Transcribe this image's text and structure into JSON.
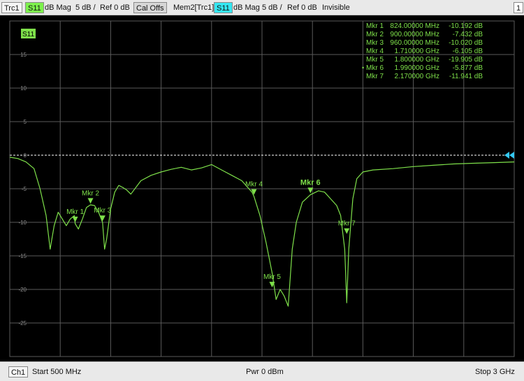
{
  "header": {
    "trace_name": "Trc1",
    "parameter": "S11",
    "format": "dB Mag",
    "scale": "5 dB /",
    "reference": "Ref 0 dB",
    "cal_status": "Cal Offs",
    "memory_trace": "Mem2[Trc1]",
    "memory_parameter": "S11",
    "memory_format": "dB Mag",
    "memory_scale": "5 dB /",
    "memory_reference": "Ref 0 dB",
    "memory_state": "Invisible",
    "window_number": "1"
  },
  "footer": {
    "channel": "Ch1",
    "start": "Start  500 MHz",
    "power": "Pwr  0 dBm",
    "stop": "Stop  3 GHz"
  },
  "colors": {
    "trace": "#7ee04a",
    "grid": "#5a5a5a",
    "axis_text": "#8a8a8a",
    "reference_marker": "#34c8f2",
    "marker_text": "#7ee04a"
  },
  "chart_data": {
    "type": "line",
    "trace_label": "S11",
    "x_unit": "GHz",
    "xlim": [
      0.5,
      3.0
    ],
    "ylim": [
      -30,
      20
    ],
    "y_tick_values": [
      15,
      10,
      5,
      0,
      -5,
      -10,
      -15,
      -20,
      -25
    ],
    "y_tick_labels": [
      "15",
      "10",
      "5",
      "0",
      "-5",
      "-10",
      "-15",
      "-20",
      "-25"
    ],
    "reference_level": 0,
    "x_divisions": 10,
    "grid": true,
    "series": [
      {
        "x": [
          0.5,
          0.54,
          0.58,
          0.62,
          0.65,
          0.68,
          0.7,
          0.72,
          0.74,
          0.76,
          0.78,
          0.8,
          0.82,
          0.824,
          0.84,
          0.86,
          0.88,
          0.9,
          0.92,
          0.94,
          0.96,
          0.97,
          0.98,
          1.0,
          1.02,
          1.04,
          1.06,
          1.08,
          1.1,
          1.15,
          1.2,
          1.25,
          1.3,
          1.35,
          1.4,
          1.45,
          1.5,
          1.55,
          1.6,
          1.65,
          1.7,
          1.71,
          1.74,
          1.77,
          1.8,
          1.82,
          1.84,
          1.86,
          1.88,
          1.9,
          1.92,
          1.95,
          1.99,
          2.03,
          2.06,
          2.09,
          2.12,
          2.14,
          2.16,
          2.17,
          2.18,
          2.2,
          2.22,
          2.25,
          2.3,
          2.4,
          2.5,
          2.6,
          2.7,
          2.8,
          2.9,
          3.0
        ],
        "y": [
          -0.3,
          -0.5,
          -1.0,
          -2.0,
          -5.0,
          -9.0,
          -14.0,
          -10.5,
          -8.5,
          -9.5,
          -10.5,
          -9.5,
          -9.0,
          -10.2,
          -11.0,
          -9.5,
          -7.8,
          -7.4,
          -7.5,
          -8.5,
          -10.0,
          -14.0,
          -12.5,
          -8.0,
          -5.5,
          -4.5,
          -4.8,
          -5.2,
          -5.8,
          -3.8,
          -3.0,
          -2.5,
          -2.1,
          -1.8,
          -2.2,
          -1.9,
          -1.4,
          -2.2,
          -3.0,
          -3.8,
          -5.5,
          -6.1,
          -9.0,
          -13.0,
          -17.5,
          -21.5,
          -20.0,
          -21.0,
          -22.5,
          -14.0,
          -10.0,
          -7.0,
          -5.9,
          -5.3,
          -5.5,
          -6.5,
          -7.5,
          -9.0,
          -14.0,
          -22.0,
          -14.0,
          -6.5,
          -3.5,
          -2.5,
          -2.2,
          -2.0,
          -1.7,
          -1.5,
          -1.3,
          -1.2,
          -1.1,
          -1.0
        ]
      }
    ],
    "markers": [
      {
        "name": "Mkr 1",
        "freq_label": "824.00000 MHz",
        "value_label": "-10.192 dB",
        "x": 0.824,
        "y": -10.192,
        "active": false
      },
      {
        "name": "Mkr 2",
        "freq_label": "900.00000 MHz",
        "value_label": "-7.432 dB",
        "x": 0.9,
        "y": -7.432,
        "active": false
      },
      {
        "name": "Mkr 3",
        "freq_label": "960.00000 MHz",
        "value_label": "-10.020 dB",
        "x": 0.96,
        "y": -10.02,
        "active": false
      },
      {
        "name": "Mkr 4",
        "freq_label": "1.710000 GHz",
        "value_label": "-6.105 dB",
        "x": 1.71,
        "y": -6.105,
        "active": false
      },
      {
        "name": "Mkr 5",
        "freq_label": "1.800000 GHz",
        "value_label": "-19.905 dB",
        "x": 1.8,
        "y": -19.905,
        "active": false
      },
      {
        "name": "Mkr 6",
        "freq_label": "1.990000 GHz",
        "value_label": "-5.877 dB",
        "x": 1.99,
        "y": -5.877,
        "active": true
      },
      {
        "name": "Mkr 7",
        "freq_label": "2.170000 GHz",
        "value_label": "-11.941 dB",
        "x": 2.17,
        "y": -11.941,
        "active": false
      }
    ]
  }
}
